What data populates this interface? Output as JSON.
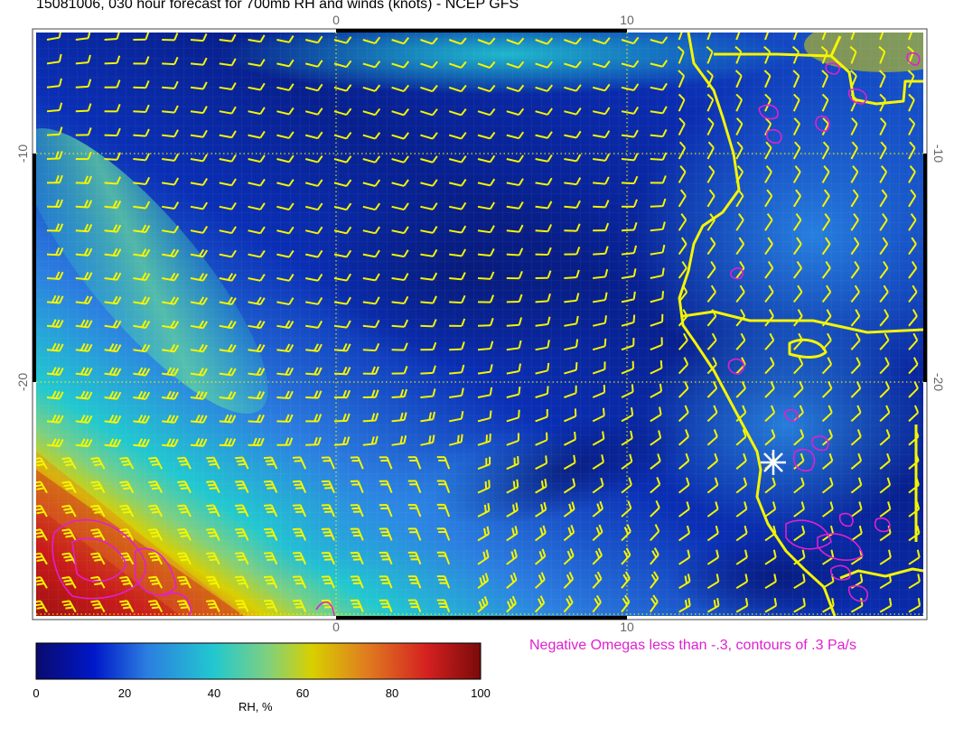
{
  "title": "15081006, 030 hour forecast for 700mb RH and winds (knots) - NCEP GFS",
  "axes": {
    "top_ticks": [
      "0",
      "10"
    ],
    "bottom_ticks": [
      "0",
      "10"
    ],
    "left_ticks": [
      "-10",
      "-20"
    ],
    "right_ticks": [
      "-10",
      "-20"
    ]
  },
  "omega_note": "Negative Omegas less than -.3, contours of .3 Pa/s",
  "colorbar": {
    "label": "RH, %",
    "ticks": [
      "0",
      "20",
      "40",
      "60",
      "80",
      "100"
    ],
    "min": 0,
    "max": 100
  },
  "colors": {
    "barbs": "#f5f500",
    "coast": "#f5f500",
    "omega": "#e020d0",
    "marker": "#ffffff"
  },
  "colormap": [
    "#0a0a6e",
    "#0018c8",
    "#2c7ee0",
    "#22c8d0",
    "#7ed080",
    "#d8d000",
    "#e07820",
    "#d42020",
    "#7a0a0a"
  ]
}
